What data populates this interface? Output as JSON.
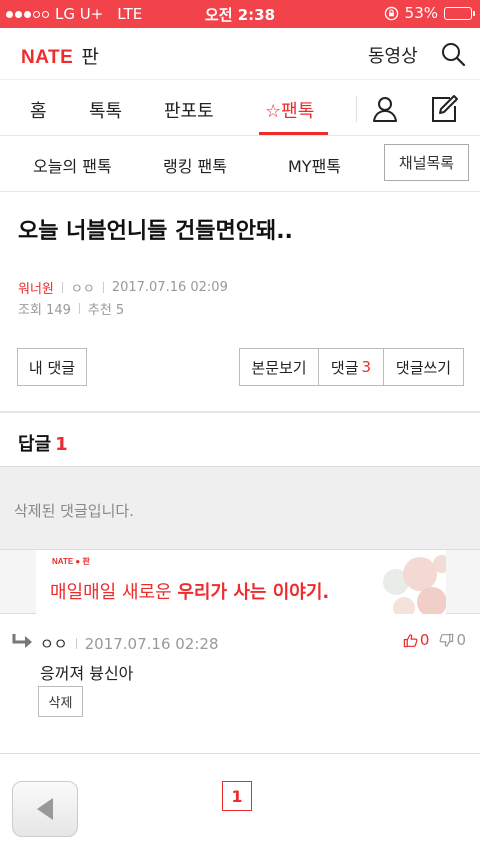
{
  "status_bar": {
    "carrier": "LG U+",
    "network": "LTE",
    "time": "오전 2:38",
    "battery": "53%",
    "battery_level": 0.53
  },
  "header": {
    "logo_nate": "NATE",
    "logo_pan": "판",
    "video_link": "동영상",
    "search_icon": "search-icon"
  },
  "main_nav": {
    "tabs": [
      {
        "label": "홈"
      },
      {
        "label": "톡톡"
      },
      {
        "label": "판포토"
      },
      {
        "label": "팬톡",
        "active": true
      }
    ],
    "star_icon": "☆",
    "user_icon": "user-icon",
    "write_icon": "edit-icon"
  },
  "sub_nav": {
    "items": [
      {
        "label": "오늘의 팬톡"
      },
      {
        "label": "랭킹 팬톡"
      },
      {
        "label": "MY팬톡"
      }
    ],
    "channel_list": "채널목록"
  },
  "post": {
    "title": "오늘 너블언니들 건들면안돼..",
    "author": "워너원",
    "user_mask": "ㅇㅇ",
    "datetime": "2017.07.16 02:09",
    "views": "조회 149",
    "recommends": "추천 5"
  },
  "actions": {
    "my_comments": "내 댓글",
    "view_post": "본문보기",
    "comments_label": "댓글",
    "comments_count": "3",
    "write_comment": "댓글쓰기"
  },
  "replies": {
    "heading": "답글",
    "count": "1",
    "deleted_text": "삭제된 댓글입니다."
  },
  "banner": {
    "brand": "NATE ● 판",
    "copy_plain": "매일매일 새로운 ",
    "copy_bold": "우리가 사는 이야기."
  },
  "comment": {
    "author": "ㅇㅇ",
    "datetime": "2017.07.16 02:28",
    "body": "응꺼져 븅신아",
    "delete": "삭제",
    "up_votes": "0",
    "down_votes": "0"
  },
  "pagination": {
    "current": "1"
  },
  "colors": {
    "accent": "#ee2c2c",
    "status_bar": "#f2434a"
  }
}
